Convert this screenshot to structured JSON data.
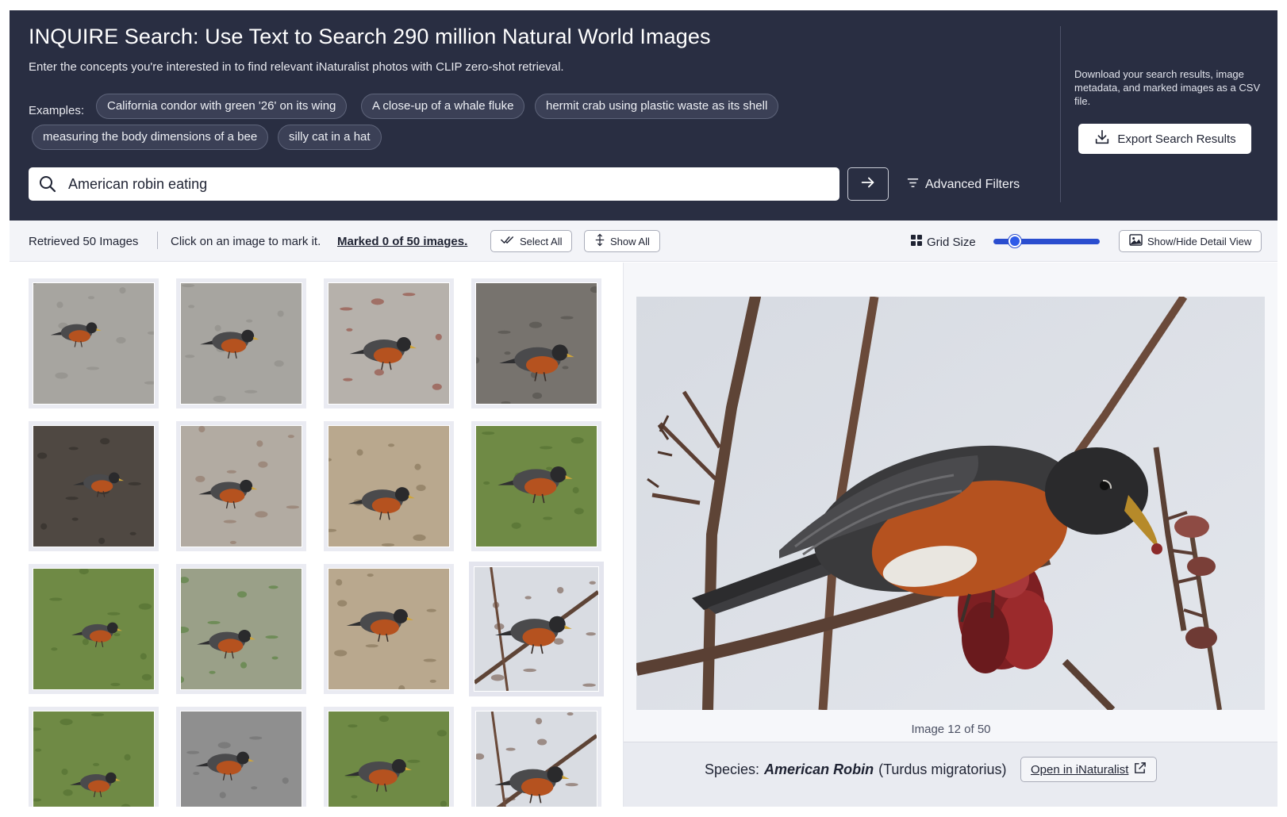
{
  "header": {
    "title": "INQUIRE Search: Use Text to Search 290 million Natural World Images",
    "subtitle": "Enter the concepts you're interested in to find relevant iNaturalist photos with CLIP zero-shot retrieval.",
    "examples_label": "Examples:",
    "examples": [
      "California condor with green '26' on its wing",
      "A close-up of a whale fluke",
      "hermit crab using plastic waste as its shell",
      "measuring the body dimensions of a bee",
      "silly cat in a hat"
    ],
    "search": {
      "value": "American robin eating",
      "icon": "search-icon",
      "submit_icon": "arrow-right-icon"
    },
    "advanced_filters_label": "Advanced Filters",
    "export": {
      "description": "Download your search results, image metadata, and marked images as a CSV file.",
      "button_label": "Export Search Results",
      "icon": "download-icon"
    }
  },
  "toolbar": {
    "retrieved": "Retrieved 50 Images",
    "instruction": "Click on an image to mark it.",
    "marked_prefix": "Marked",
    "marked_count": "0 of 50",
    "marked_suffix": "images.",
    "select_all_label": "Select All",
    "show_all_label": "Show All",
    "grid_size_label": "Grid Size",
    "grid_size_value": 0.2,
    "detail_toggle_label": "Show/Hide Detail View"
  },
  "gallery": {
    "images": [
      {
        "scene": "pavement",
        "selected": false
      },
      {
        "scene": "pavement",
        "selected": false
      },
      {
        "scene": "pavement-leaves",
        "selected": false
      },
      {
        "scene": "gravel",
        "selected": false
      },
      {
        "scene": "dark-ground",
        "selected": false
      },
      {
        "scene": "sidewalk",
        "selected": false
      },
      {
        "scene": "dry-grass",
        "selected": false
      },
      {
        "scene": "grass",
        "selected": false
      },
      {
        "scene": "grass",
        "selected": false
      },
      {
        "scene": "grass-path",
        "selected": false
      },
      {
        "scene": "dry-grass",
        "selected": false
      },
      {
        "scene": "branch",
        "selected": true
      },
      {
        "scene": "grass",
        "selected": false
      },
      {
        "scene": "grey",
        "selected": false
      },
      {
        "scene": "grass",
        "selected": false
      },
      {
        "scene": "branch",
        "selected": false
      }
    ]
  },
  "detail": {
    "counter": "Image 12 of 50",
    "species_label": "Species:",
    "common_name": "American Robin",
    "scientific_name": "(Turdus migratorius)",
    "open_label": "Open in iNaturalist",
    "open_icon": "external-link-icon"
  },
  "colors": {
    "header_bg": "#292e42",
    "accent": "#2f5be8",
    "robin_breast": "#b5521f"
  }
}
